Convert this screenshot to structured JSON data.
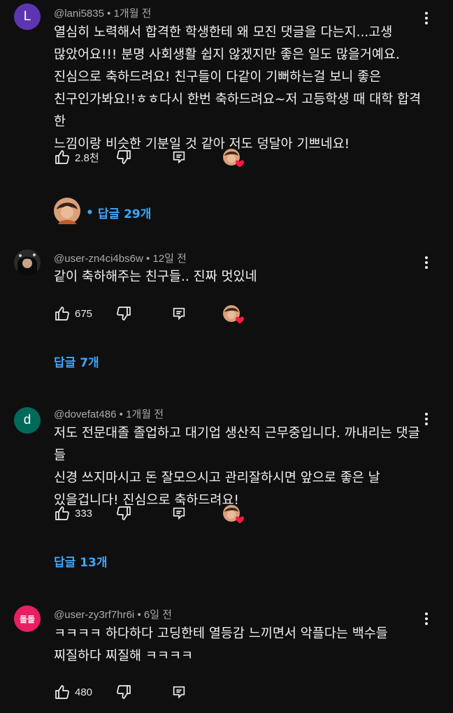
{
  "comments": [
    {
      "author": "@lani5835",
      "time": "1개월 전",
      "avatar_letter": "L",
      "avatar_color": "#5e35b1",
      "text": "열심히 노력해서 합격한 학생한테 왜 모진 댓글을 다는지...고생\n많았어요!!! 분명 사회생활 쉽지 않겠지만 좋은 일도 많을거예요.\n진심으로 축하드려요! 친구들이 다같이 기뻐하는걸 보니 좋은\n친구인가봐요!!ㅎㅎ다시 한번 축하드려요~저 고등학생 때 대학 합격한\n느낌이랑 비슷한 기분일 것 같아 저도 덩달아 기쁘네요!",
      "likes": "2.8천",
      "replies": "답글 29개"
    },
    {
      "author": "@user-zn4ci4bs6w",
      "time": "12일 전",
      "text": "같이 축하해주는 친구들.. 진짜 멋있네",
      "likes": "675",
      "replies": "답글 7개"
    },
    {
      "author": "@dovefat486",
      "time": "1개월 전",
      "avatar_letter": "d",
      "avatar_color": "#00695c",
      "text": "저도 전문대졸 졸업하고 대기업 생산직 근무중입니다. 까내리는 댓글들\n신경 쓰지마시고 돈 잘모으시고 관리잘하시면 앞으로 좋은 날\n있을겁니다! 진심으로 축하드려요!",
      "likes": "333",
      "replies": "답글 13개"
    },
    {
      "author": "@user-zy3rf7hr6i",
      "time": "6일 전",
      "avatar_letter": "돌돌",
      "avatar_color": "#e91e63",
      "text": "ㅋㅋㅋㅋ 하다하다 고딩한테 열등감 느끼면서 악플다는 백수들\n찌질하다 찌질해 ㅋㅋㅋㅋ",
      "likes": "480"
    }
  ],
  "separator": "•",
  "colors": {
    "link": "#3ea6ff",
    "heart": "#ff1744"
  }
}
